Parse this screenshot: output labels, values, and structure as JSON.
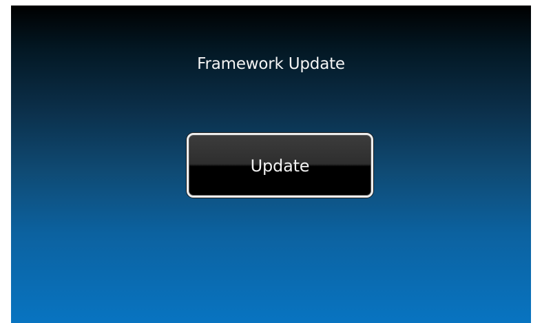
{
  "screen": {
    "title": "Framework Update",
    "background_top": "#000000",
    "background_bottom": "#0874c1"
  },
  "update_button": {
    "label": "Update",
    "border_color": "#eeeeee"
  }
}
